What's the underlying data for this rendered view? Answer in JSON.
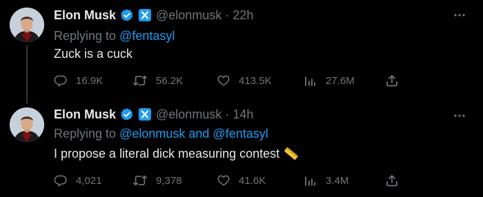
{
  "colors": {
    "background": "#000000",
    "primary_text": "#e7e9ea",
    "secondary_text": "#71767b",
    "link": "#1d9bf0",
    "verified_badge": "#1d9bf0",
    "org_badge": "#1d9bf0",
    "thread_line": "#333639"
  },
  "tweets": [
    {
      "author": {
        "name": "Elon Musk",
        "handle": "@elonmusk",
        "avatar_icon": "avatar-elon-musk",
        "verified_icon": "verified-badge-icon",
        "org_icon": "x-org-badge-icon"
      },
      "separator": "·",
      "time": "22h",
      "replying_prefix": "Replying to",
      "replying_to": "@fentasyl",
      "text": "Zuck is a cuck",
      "emoji": "",
      "stats": {
        "replies": "16.9K",
        "retweets": "56.2K",
        "likes": "413.5K",
        "views": "27.6M"
      }
    },
    {
      "author": {
        "name": "Elon Musk",
        "handle": "@elonmusk",
        "avatar_icon": "avatar-elon-musk",
        "verified_icon": "verified-badge-icon",
        "org_icon": "x-org-badge-icon"
      },
      "separator": "·",
      "time": "14h",
      "replying_prefix": "Replying to",
      "replying_to": "@elonmusk and @fentasyl",
      "text": "I propose a literal dick measuring contest",
      "emoji": "straight-ruler-emoji",
      "stats": {
        "replies": "4,021",
        "retweets": "9,378",
        "likes": "41.6K",
        "views": "3.4M"
      }
    }
  ]
}
